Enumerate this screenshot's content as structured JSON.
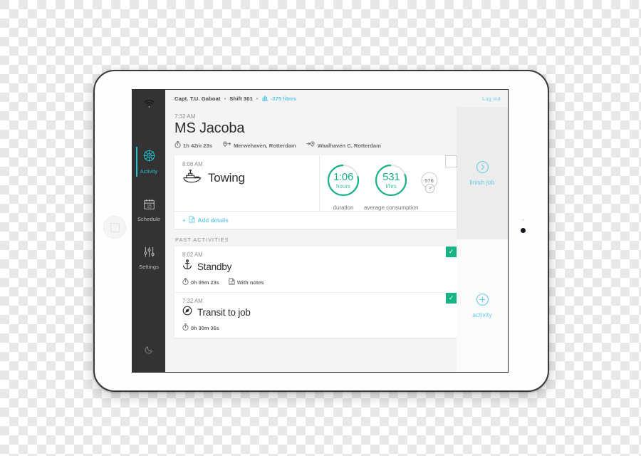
{
  "theme": {
    "sidebar_bg": "#333333",
    "accent_teal": "#1fc0cf",
    "accent_blue": "#6fcde9",
    "gauge_green": "#17b187",
    "check_green": "#19b486",
    "screen_bg": "#f4f4f4"
  },
  "sidebar": {
    "status_icon": "wifi-icon",
    "items": [
      {
        "label": "Activity",
        "icon": "ship-wheel-icon",
        "active": true
      },
      {
        "label": "Schedule",
        "icon": "calendar-icon",
        "day": "15",
        "active": false
      },
      {
        "label": "Settings",
        "icon": "sliders-icon",
        "active": false
      }
    ],
    "bottom_icon": "moon-icon"
  },
  "topbar": {
    "captain": "Capt. T.U. Gaboat",
    "separator": "•",
    "shift": "Shift 301",
    "fuel_icon": "bar-chart-icon",
    "fuel_delta": "-375 liters",
    "logout": "Log out"
  },
  "job": {
    "time": "7:32 AM",
    "title": "MS Jacoba",
    "duration_icon": "stopwatch-icon",
    "duration": "1h 42m 23s",
    "origin_icon": "pin-depart-icon",
    "origin": "Merwehaven, Rotterdam",
    "destination_icon": "pin-arrive-icon",
    "destination": "Waalhaven C, Rotterdam"
  },
  "current_activity": {
    "time": "8:08 AM",
    "icon": "tugboat-icon",
    "name": "Towing",
    "gauges": [
      {
        "value": "1:06",
        "unit": "hours",
        "caption": "duration",
        "percent": 82
      },
      {
        "value": "531",
        "unit": "l/hrs",
        "caption": "average consumption",
        "percent": 88
      }
    ],
    "mini_gauge": {
      "value": "576",
      "icon": "speedometer-icon"
    },
    "add_details": "Add details",
    "add_details_icon": "document-icon",
    "add_details_plus": "+"
  },
  "past_activities": {
    "heading": "PAST ACTIVITIES",
    "items": [
      {
        "time": "8:02 AM",
        "icon": "anchor-icon",
        "name": "Standby",
        "duration_icon": "stopwatch-icon",
        "duration": "0h 05m 23s",
        "notes_icon": "document-icon",
        "notes": "With notes",
        "checked": true
      },
      {
        "time": "7:32 AM",
        "icon": "compass-icon",
        "name": "Transit to job",
        "duration_icon": "stopwatch-icon",
        "duration": "0h 30m 36s",
        "notes_icon": null,
        "notes": null,
        "checked": true
      }
    ]
  },
  "actions": [
    {
      "label": "finish job",
      "icon": "chevron-right-circle-icon"
    },
    {
      "label": "activity",
      "icon": "plus-circle-icon"
    }
  ]
}
